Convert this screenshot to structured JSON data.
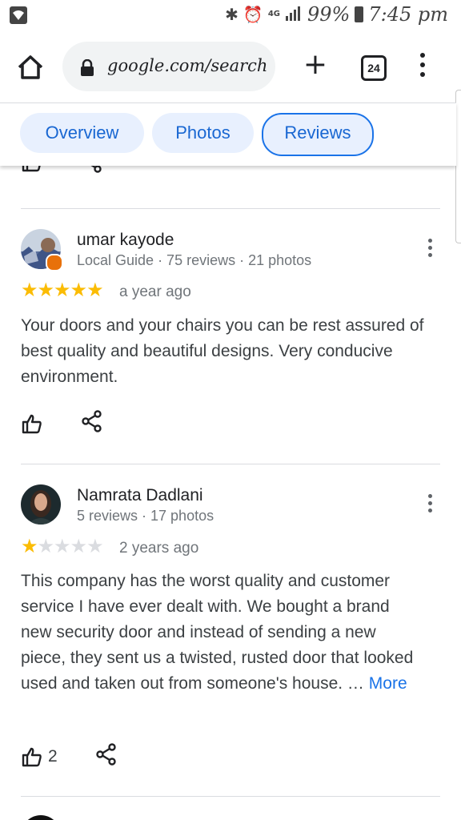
{
  "status_bar": {
    "battery": "99%",
    "time": "7:45 pm",
    "network": "4G",
    "icons": [
      "wifi-icon",
      "bluetooth-icon",
      "alarm-icon",
      "signal-icon",
      "battery-icon"
    ]
  },
  "browser": {
    "url": "google.com/search?q",
    "tab_count": "24",
    "icons": [
      "home-icon",
      "lock-icon",
      "plus-icon",
      "tabs-icon",
      "more-vert-icon"
    ]
  },
  "tabs": [
    {
      "label": "Overview",
      "active": false
    },
    {
      "label": "Photos",
      "active": false
    },
    {
      "label": "Reviews",
      "active": true
    }
  ],
  "reviews": [
    {
      "name": "umar kayode",
      "meta": "Local Guide · 75 reviews · 21 photos",
      "rating": 5,
      "date": "a year ago",
      "text": "Your doors and your chairs you can be rest assured of best quality and beautiful designs. Very conducive environment.",
      "likes": ""
    },
    {
      "name": "Namrata Dadlani",
      "meta": "5 reviews · 17 photos",
      "rating": 1,
      "date": "2 years ago",
      "text": "This company has the worst quality and customer service I have ever dealt with. We bought a brand new security door and instead of sending a new piece, they sent us a twisted, rusted door that looked used and taken out from someone's house. …",
      "more": "More",
      "likes": "2"
    }
  ],
  "colors": {
    "accent": "#1a73e8",
    "chip_bg": "#e8f0fe",
    "star": "#fbbc04",
    "star_empty": "#dadce0",
    "guide_badge": "#e8710a"
  }
}
